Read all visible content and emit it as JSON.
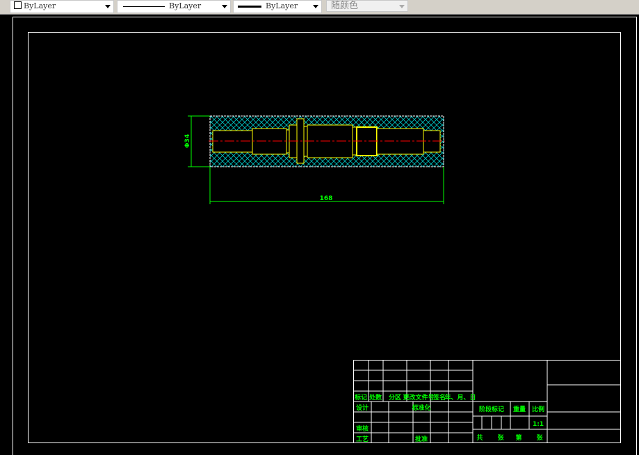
{
  "toolbar": {
    "color": "ByLayer",
    "linetype": "ByLayer",
    "lineweight": "ByLayer",
    "plotstyle": "随颜色"
  },
  "drawing": {
    "dim_diameter": "Φ34",
    "dim_length": "168",
    "colors": {
      "outline": "#ffff00",
      "hatch": "#00c8c8",
      "centerline": "#ff0000",
      "dimension": "#00ff00",
      "frame": "#ffffff"
    }
  },
  "title_block": {
    "headers": [
      "标记",
      "处数",
      "分区",
      "更改文件号",
      "签名",
      "年、月、日"
    ],
    "design": "设计",
    "standardization": "标准化",
    "review": "审核",
    "process": "工艺",
    "approve": "批准",
    "stage_mark": "阶段标记",
    "weight": "重量",
    "scale_label": "比例",
    "scale": "1:1",
    "total": "共",
    "sheets1": "张",
    "page": "第",
    "sheets2": "张"
  }
}
